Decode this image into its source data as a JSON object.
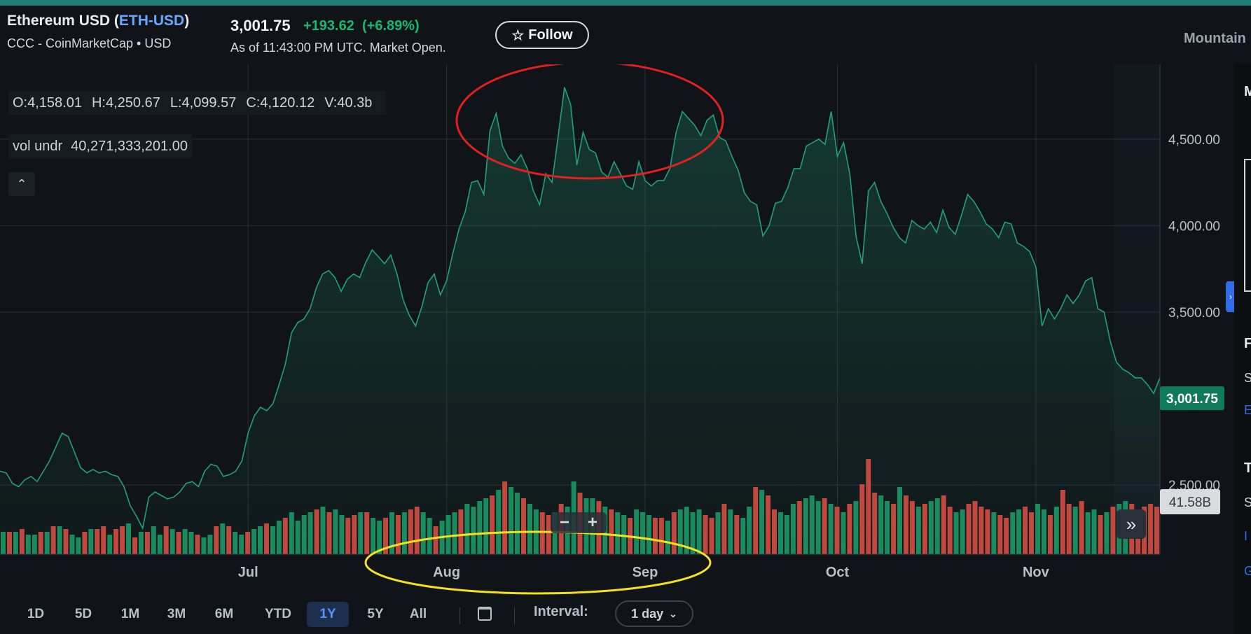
{
  "header": {
    "name": "Ethereum USD (",
    "symbol": "ETH-USD",
    "name_close": ")",
    "source": "CCC - CoinMarketCap • USD",
    "price": "3,001.75",
    "change": "+193.62",
    "change_pct": "(+6.89%)",
    "as_of": "As of 11:43:00 PM UTC. Market Open.",
    "follow_label": "Follow",
    "chart_style": "Mountain"
  },
  "legend": {
    "open": "O:4,158.01",
    "high": "H:4,250.67",
    "low": "L:4,099.57",
    "close": "C:4,120.12",
    "volume": "V:40.3b",
    "vol_undr_label": "vol undr",
    "vol_undr_value": "40,271,333,201.00"
  },
  "right_panel": {
    "p1": "M",
    "p2": "F",
    "p3": "S",
    "p4": "E",
    "p5": "T",
    "p6": "S",
    "p7": "I",
    "p8": "G"
  },
  "controls": {
    "ranges": [
      "1D",
      "5D",
      "1M",
      "3M",
      "6M",
      "YTD",
      "1Y",
      "5Y",
      "All"
    ],
    "active_range": "1Y",
    "interval_label": "Interval:",
    "interval_value": "1 day"
  },
  "colors": {
    "up": "#1a8a5f",
    "down": "#c0483e",
    "line": "#23a07a",
    "price_tag_bg": "#117a5a",
    "annotation_red": "#e22020",
    "annotation_yellow": "#f5e11d"
  },
  "chart_data": {
    "type": "area",
    "ylim": [
      2100,
      4900
    ],
    "yticks": [
      "4,500.00",
      "4,000.00",
      "3,500.00",
      "2,500.00"
    ],
    "ytick_values": [
      4500,
      4000,
      3500,
      2500
    ],
    "xticks": [
      "Jul",
      "Aug",
      "Sep",
      "Oct",
      "Nov"
    ],
    "current_price": 3001.75,
    "current_price_label": "3,001.75",
    "current_volume_label": "41.58B",
    "price": [
      2580,
      2570,
      2510,
      2490,
      2530,
      2550,
      2520,
      2580,
      2640,
      2720,
      2800,
      2780,
      2690,
      2600,
      2570,
      2590,
      2570,
      2580,
      2560,
      2550,
      2490,
      2380,
      2320,
      2250,
      2430,
      2460,
      2440,
      2420,
      2430,
      2460,
      2510,
      2520,
      2490,
      2580,
      2620,
      2610,
      2550,
      2560,
      2580,
      2640,
      2800,
      2900,
      2950,
      2930,
      2970,
      3080,
      3200,
      3380,
      3440,
      3460,
      3520,
      3640,
      3720,
      3740,
      3700,
      3620,
      3690,
      3720,
      3700,
      3790,
      3860,
      3820,
      3780,
      3830,
      3720,
      3570,
      3480,
      3420,
      3530,
      3670,
      3720,
      3600,
      3680,
      3840,
      3980,
      4080,
      4250,
      4260,
      4180,
      4550,
      4650,
      4460,
      4390,
      4360,
      4410,
      4330,
      4200,
      4120,
      4300,
      4250,
      4520,
      4800,
      4700,
      4350,
      4540,
      4440,
      4420,
      4310,
      4280,
      4370,
      4300,
      4230,
      4210,
      4370,
      4260,
      4230,
      4260,
      4260,
      4330,
      4540,
      4660,
      4620,
      4580,
      4520,
      4610,
      4640,
      4510,
      4490,
      4400,
      4320,
      4190,
      4140,
      4120,
      3940,
      4000,
      4130,
      4140,
      4220,
      4330,
      4330,
      4460,
      4480,
      4500,
      4470,
      4660,
      4400,
      4480,
      4300,
      3940,
      3780,
      4200,
      4250,
      4140,
      4070,
      3990,
      3930,
      3900,
      4030,
      4000,
      3980,
      4020,
      3960,
      4090,
      3990,
      3950,
      4060,
      4180,
      4140,
      4080,
      4010,
      3980,
      3930,
      4020,
      4010,
      3900,
      3880,
      3850,
      3760,
      3420,
      3520,
      3460,
      3520,
      3600,
      3550,
      3600,
      3680,
      3700,
      3520,
      3500,
      3330,
      3210,
      3170,
      3150,
      3120,
      3120,
      3080,
      3030,
      3120
    ],
    "volume": [
      16,
      16,
      16,
      18,
      14,
      14,
      16,
      16,
      20,
      20,
      18,
      14,
      12,
      16,
      18,
      18,
      20,
      14,
      18,
      20,
      22,
      12,
      16,
      16,
      20,
      14,
      20,
      18,
      16,
      18,
      16,
      14,
      12,
      14,
      20,
      22,
      20,
      16,
      14,
      16,
      18,
      20,
      22,
      20,
      24,
      26,
      30,
      24,
      28,
      30,
      32,
      34,
      30,
      32,
      28,
      26,
      28,
      30,
      30,
      26,
      24,
      26,
      30,
      28,
      30,
      32,
      34,
      30,
      26,
      20,
      24,
      28,
      30,
      32,
      36,
      34,
      38,
      40,
      42,
      46,
      52,
      48,
      44,
      40,
      36,
      32,
      30,
      28,
      30,
      36,
      34,
      52,
      44,
      40,
      40,
      38,
      34,
      32,
      30,
      28,
      26,
      32,
      30,
      28,
      26,
      26,
      24,
      30,
      32,
      34,
      30,
      32,
      28,
      26,
      30,
      36,
      32,
      28,
      26,
      34,
      48,
      46,
      42,
      32,
      30,
      28,
      36,
      38,
      40,
      42,
      38,
      40,
      36,
      34,
      30,
      36,
      38,
      50,
      68,
      44,
      42,
      38,
      36,
      48,
      42,
      38,
      34,
      36,
      38,
      40,
      42,
      34,
      30,
      32,
      36,
      38,
      34,
      32,
      30,
      28,
      26,
      30,
      32,
      34,
      30,
      36,
      32,
      28,
      34,
      46,
      36,
      34,
      38,
      30,
      32,
      28,
      30,
      34,
      36,
      38,
      36,
      30,
      34,
      36,
      34
    ],
    "volume_up": [
      1,
      0,
      1,
      0,
      1,
      1,
      0,
      1,
      0,
      1,
      0,
      1,
      1,
      0,
      1,
      0,
      0,
      1,
      0,
      0,
      1,
      0,
      1,
      0,
      1,
      1,
      0,
      1,
      0,
      1,
      1,
      0,
      1,
      1,
      0,
      1,
      0,
      1,
      1,
      0,
      1,
      1,
      0,
      1,
      1,
      0,
      1,
      1,
      1,
      1,
      0,
      1,
      0,
      1,
      1,
      0,
      0,
      1,
      0,
      1,
      1,
      0,
      1,
      0,
      1,
      0,
      0,
      1,
      1,
      0,
      1,
      1,
      1,
      0,
      1,
      1,
      1,
      1,
      0,
      1,
      0,
      1,
      1,
      0,
      1,
      1,
      0,
      0,
      1,
      0,
      1,
      1,
      0,
      1,
      1,
      0,
      1,
      0,
      1,
      1,
      0,
      1,
      1,
      1,
      0,
      0,
      1,
      0,
      1,
      1,
      1,
      1,
      0,
      0,
      1,
      0,
      1,
      0,
      1,
      1,
      0,
      1,
      0,
      0,
      1,
      1,
      1,
      0,
      1,
      1,
      1,
      0,
      1,
      0,
      1,
      0,
      1,
      0,
      0,
      0,
      1,
      1,
      0,
      1,
      0,
      0,
      1,
      0,
      1,
      1,
      0,
      0,
      1,
      1,
      0,
      0,
      0,
      0,
      1,
      0,
      0,
      1,
      1,
      0,
      0,
      1,
      1,
      0,
      1,
      0,
      0,
      1,
      0,
      1,
      1,
      0,
      1,
      0,
      1,
      1,
      0,
      0,
      0,
      0,
      0
    ]
  }
}
